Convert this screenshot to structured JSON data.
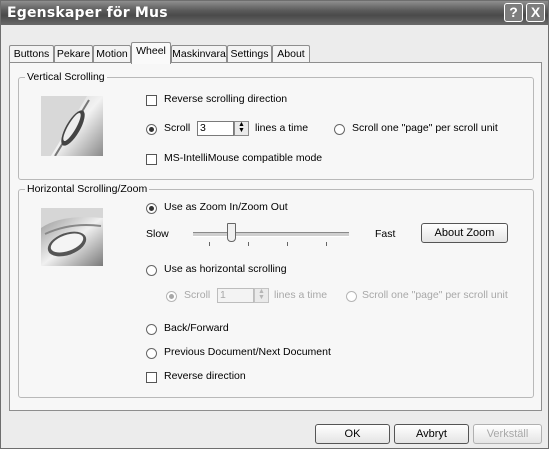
{
  "window": {
    "title": "Egenskaper för Mus"
  },
  "titlebar_buttons": [
    "?",
    "X"
  ],
  "tabs": [
    {
      "label": "Buttons"
    },
    {
      "label": "Pekare"
    },
    {
      "label": "Motion"
    },
    {
      "label": "Wheel"
    },
    {
      "label": "Maskinvara"
    },
    {
      "label": "Settings"
    },
    {
      "label": "About"
    }
  ],
  "active_tab": "Wheel",
  "vertical": {
    "title": "Vertical Scrolling",
    "reverse_label": "Reverse scrolling direction",
    "scroll_label": "Scroll",
    "scroll_value": "3",
    "lines_label": "lines a time",
    "page_label": "Scroll one \"page\" per scroll unit",
    "compat_label": "MS-IntelliMouse compatible mode"
  },
  "horizontal": {
    "title": "Horizontal Scrolling/Zoom",
    "zoom_label": "Use as Zoom In/Zoom Out",
    "slow_label": "Slow",
    "fast_label": "Fast",
    "about_zoom_label": "About Zoom",
    "hscroll_label": "Use as horizontal scrolling",
    "scroll_label": "Scroll",
    "scroll_value": "1",
    "lines_label": "lines a time",
    "page_label": "Scroll one \"page\" per scroll unit",
    "back_forward_label": "Back/Forward",
    "prev_next_label": "Previous Document/Next Document",
    "reverse_label": "Reverse direction"
  },
  "footer": {
    "ok_label": "OK",
    "cancel_label": "Avbryt",
    "apply_label": "Verkställ"
  },
  "colors": {
    "titlebar": "#5a5a5a",
    "panel": "#f7f7f7"
  }
}
